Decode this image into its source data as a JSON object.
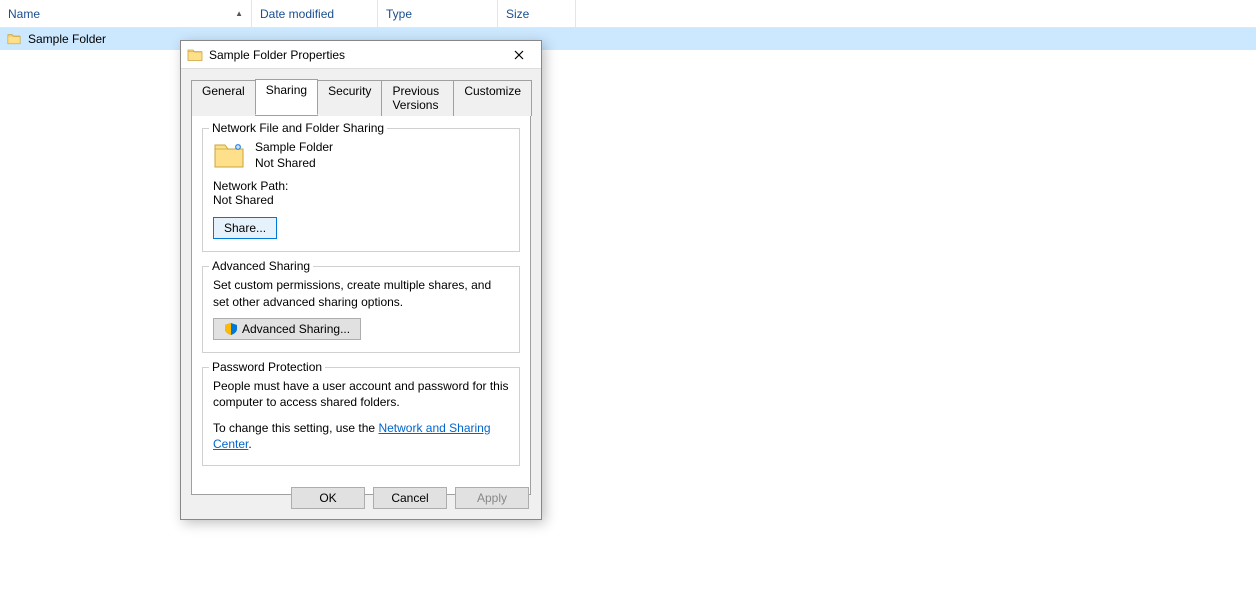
{
  "explorer": {
    "columns": {
      "name": "Name",
      "modified": "Date modified",
      "type": "Type",
      "size": "Size"
    },
    "rows": [
      {
        "name": "Sample Folder"
      }
    ]
  },
  "dialog": {
    "title": "Sample Folder Properties",
    "tabs": {
      "general": "General",
      "sharing": "Sharing",
      "security": "Security",
      "previous": "Previous Versions",
      "customize": "Customize"
    },
    "sharing": {
      "group1": {
        "legend": "Network File and Folder Sharing",
        "folder_name": "Sample Folder",
        "status": "Not Shared",
        "path_label": "Network Path:",
        "path_value": "Not Shared",
        "share_btn": "Share..."
      },
      "group2": {
        "legend": "Advanced Sharing",
        "desc": "Set custom permissions, create multiple shares, and set other advanced sharing options.",
        "btn": "Advanced Sharing..."
      },
      "group3": {
        "legend": "Password Protection",
        "desc": "People must have a user account and password for this computer to access shared folders.",
        "change_prefix": "To change this setting, use the ",
        "link": "Network and Sharing Center",
        "change_suffix": "."
      }
    },
    "buttons": {
      "ok": "OK",
      "cancel": "Cancel",
      "apply": "Apply"
    }
  }
}
